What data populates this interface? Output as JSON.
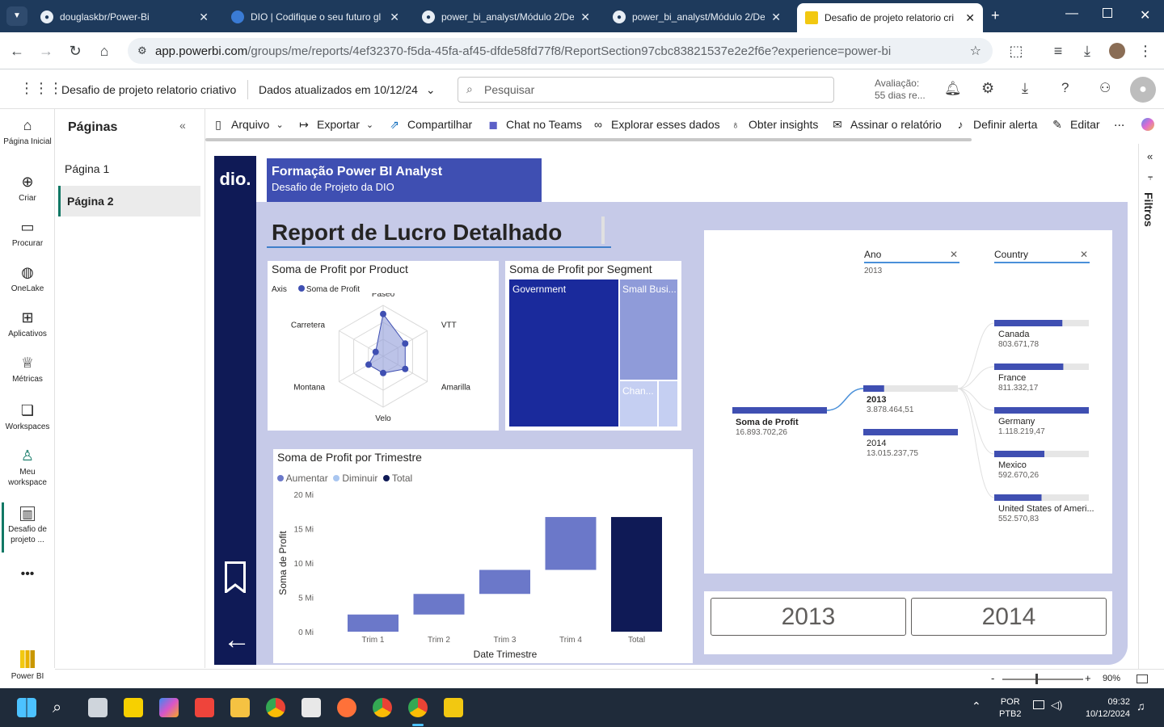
{
  "browser": {
    "tabs": [
      {
        "title": "douglaskbr/Power-Bi"
      },
      {
        "title": "DIO | Codifique o seu futuro gl"
      },
      {
        "title": "power_bi_analyst/Módulo 2/De"
      },
      {
        "title": "power_bi_analyst/Módulo 2/De"
      },
      {
        "title": "Desafio de projeto relatorio cri"
      }
    ],
    "url_host": "app.powerbi.com",
    "url_path": "/groups/me/reports/4ef32370-f5da-45fa-af45-dfde58fd77f8/ReportSection97cbc83821537e2e2f6e?experience=power-bi"
  },
  "header": {
    "report_name": "Desafio de projeto relatorio criativo",
    "data_updated": "Dados atualizados em 10/12/24",
    "search_placeholder": "Pesquisar",
    "trial_label": "Avaliação:",
    "trial_days": "55 dias re..."
  },
  "leftnav": [
    {
      "label": "Página Inicial",
      "icon": "home-icon"
    },
    {
      "label": "Criar",
      "icon": "plus-circle-icon"
    },
    {
      "label": "Procurar",
      "icon": "folder-icon"
    },
    {
      "label": "OneLake",
      "icon": "onelake-icon"
    },
    {
      "label": "Aplicativos",
      "icon": "apps-icon"
    },
    {
      "label": "Métricas",
      "icon": "trophy-icon"
    },
    {
      "label": "Workspaces",
      "icon": "workspaces-icon"
    },
    {
      "label": "Meu workspace",
      "icon": "person-icon"
    },
    {
      "label": "Desafio de projeto ...",
      "icon": "report-icon"
    },
    {
      "label": "Power BI",
      "icon": "powerbi-icon"
    }
  ],
  "pages": {
    "title": "Páginas",
    "items": [
      "Página 1",
      "Página 2"
    ],
    "active": "Página 2"
  },
  "toolbar": {
    "arquivo": "Arquivo",
    "exportar": "Exportar",
    "compartilhar": "Compartilhar",
    "chat_teams": "Chat no Teams",
    "explorar": "Explorar esses dados",
    "insights": "Obter insights",
    "assinar": "Assinar o relatório",
    "alerta": "Definir alerta",
    "editar": "Editar",
    "more": "..."
  },
  "report": {
    "logo_text": "dio.",
    "banner_title": "Formação Power BI Analyst",
    "banner_subtitle": "Desafio de Projeto da DIO",
    "main_title": "Report de Lucro Detalhado"
  },
  "chart_data": [
    {
      "type": "radar",
      "title": "Soma de Profit por Product",
      "legend_axis": "Axis",
      "legend_series": "Soma de Profit",
      "categories": [
        "Paseo",
        "VTT",
        "Amarilla",
        "Velo",
        "Montana",
        "Carretera"
      ],
      "values": [
        0.83,
        0.5,
        0.5,
        0.33,
        0.33,
        0.17
      ]
    },
    {
      "type": "treemap",
      "title": "Soma de Profit por Segment",
      "items": [
        {
          "label": "Government",
          "color": "#1a2a9c"
        },
        {
          "label": "Small Busi...",
          "color": "#8f9bd9"
        },
        {
          "label": "Chan...",
          "color": "#c5cff2"
        }
      ]
    },
    {
      "type": "waterfall",
      "title": "Soma de Profit por Trimestre",
      "legend": [
        "Aumentar",
        "Diminuir",
        "Total"
      ],
      "categories": [
        "Trim 1",
        "Trim 2",
        "Trim 3",
        "Trim 4",
        "Total"
      ],
      "starts": [
        0,
        2.5,
        5.5,
        9,
        0
      ],
      "ends": [
        2.5,
        5.5,
        9,
        16.7,
        16.7
      ],
      "xlabel": "Date Trimestre",
      "ylabel": "Soma de Profit",
      "yticks": [
        "0 Mi",
        "5 Mi",
        "10 Mi",
        "15 Mi",
        "20 Mi"
      ],
      "ylim": [
        0,
        20
      ]
    },
    {
      "type": "decomposition_tree",
      "root": {
        "label": "Soma de Profit",
        "value": "16.893.702,26"
      },
      "level1_header": "Ano",
      "level1_filter": "2013",
      "level1": [
        {
          "label": "2013",
          "value": "3.878.464,51",
          "fraction": 0.22
        },
        {
          "label": "2014",
          "value": "13.015.237,75",
          "fraction": 1.0
        }
      ],
      "level2_header": "Country",
      "level2": [
        {
          "label": "Canada",
          "value": "803.671,78",
          "fraction": 0.72
        },
        {
          "label": "France",
          "value": "811.332,17",
          "fraction": 0.73
        },
        {
          "label": "Germany",
          "value": "1.118.219,47",
          "fraction": 1.0
        },
        {
          "label": "Mexico",
          "value": "592.670,26",
          "fraction": 0.53
        },
        {
          "label": "United States of Ameri...",
          "value": "552.570,83",
          "fraction": 0.5
        }
      ]
    }
  ],
  "year_buttons": [
    "2013",
    "2014"
  ],
  "filters_label": "Filtros",
  "status": {
    "zoom": "90%"
  },
  "taskbar": {
    "lang": "POR",
    "layout": "PTB2",
    "time": "09:32",
    "date": "10/12/2024"
  },
  "colors": {
    "accent": "#3f4fb2",
    "dark": "#0f1a56",
    "light": "#8f9bd9"
  }
}
